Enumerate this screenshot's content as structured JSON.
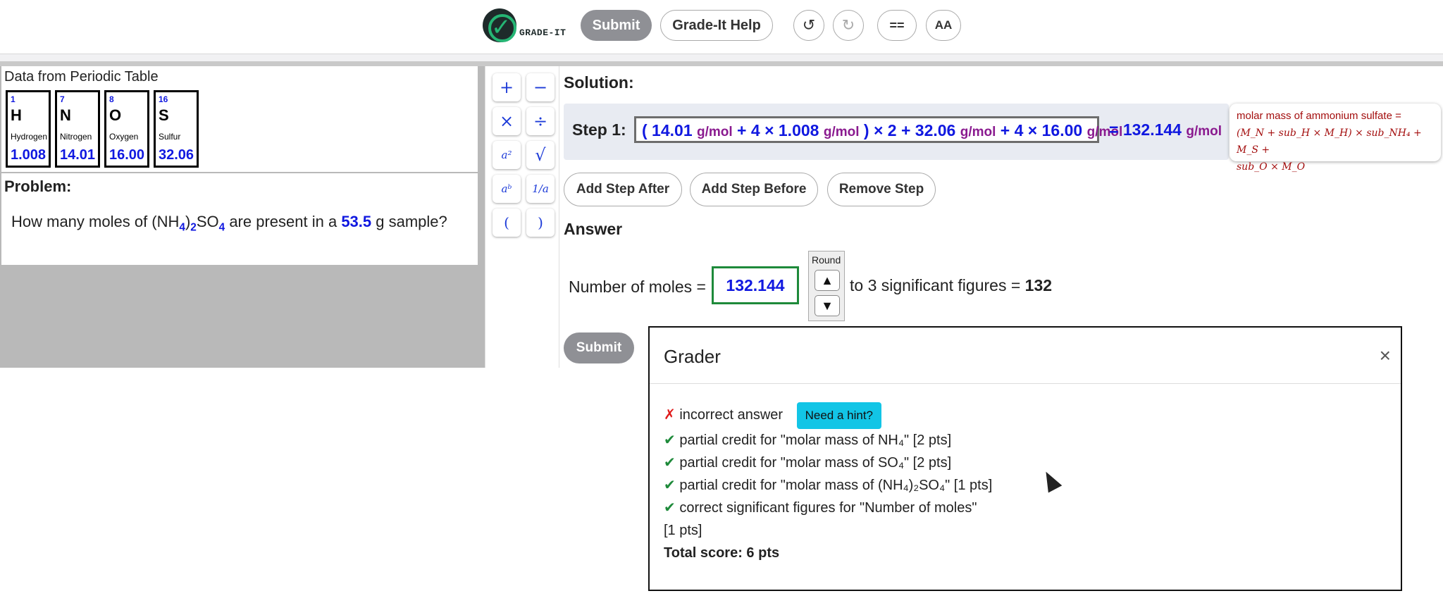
{
  "topbar": {
    "logo_text": "GRADE-IT",
    "submit_label": "Submit",
    "help_label": "Grade-It Help",
    "undo_icon": "↺",
    "redo_icon": "↻",
    "equals_icon": "==",
    "font_icon": "AA"
  },
  "periodic_table": {
    "title": "Data from Periodic Table",
    "elements": [
      {
        "number": "1",
        "symbol": "H",
        "name": "Hydrogen",
        "mass": "1.008"
      },
      {
        "number": "7",
        "symbol": "N",
        "name": "Nitrogen",
        "mass": "14.01"
      },
      {
        "number": "8",
        "symbol": "O",
        "name": "Oxygen",
        "mass": "16.00"
      },
      {
        "number": "16",
        "symbol": "S",
        "name": "Sulfur",
        "mass": "32.06"
      }
    ]
  },
  "problem": {
    "title": "Problem:",
    "text_before": "How many moles of (NH",
    "sub4": "4",
    "text_paren": ")",
    "sub2": "2",
    "text_so": "SO",
    "sub4b": "4",
    "text_mid": " are present in a ",
    "mass_value": "53.5",
    "text_after": " g sample?"
  },
  "tools": [
    "+",
    "−",
    "×",
    "÷",
    "a²",
    "√",
    "aᵇ",
    "1/a",
    "(",
    ")"
  ],
  "solution": {
    "title": "Solution:",
    "step_label": "Step 1:",
    "expr": {
      "p1": "( 14.01 ",
      "u1": "g/mol",
      "p2": " + 4 × 1.008 ",
      "u2": "g/mol",
      "p3": " ) × 2 + 32.06 ",
      "u3": "g/mol",
      "p4": " + 4 × 16.00 ",
      "u4": "g/mol"
    },
    "result_value": "= 132.144",
    "result_unit": "g/mol",
    "tooltip_line1": "molar mass of ammonium sulfate =",
    "tooltip_line2": "(M_N + sub_H × M_H) × sub_NH₄ + M_S +",
    "tooltip_line3": "sub_O × M_O",
    "buttons": {
      "after": "Add Step After",
      "before": "Add Step Before",
      "remove": "Remove Step"
    }
  },
  "answer": {
    "title": "Answer",
    "label": "Number of moles =",
    "value": "132.144",
    "round_label": "Round",
    "sig_text": "to 3 significant figures = ",
    "sig_value": "132",
    "submit_label": "Submit"
  },
  "grader": {
    "title": "Grader",
    "close": "×",
    "incorrect": "incorrect answer",
    "hint_label": "Need a hint?",
    "lines": [
      "partial credit for \"molar mass of NH₄\" [2 pts]",
      "partial credit for \"molar mass of SO₄\" [2 pts]",
      "partial credit for \"molar mass of (NH₄)₂SO₄\" [1 pts]",
      "correct significant figures for \"Number of moles\""
    ],
    "pts_line": "[1 pts]",
    "total": "Total score: 6 pts"
  },
  "colors": {
    "accent_blue": "#1018e0",
    "unit_purple": "#8a1a8f",
    "success": "#1e8a3a",
    "error": "#e01a1a",
    "hint": "#12c5e6"
  }
}
